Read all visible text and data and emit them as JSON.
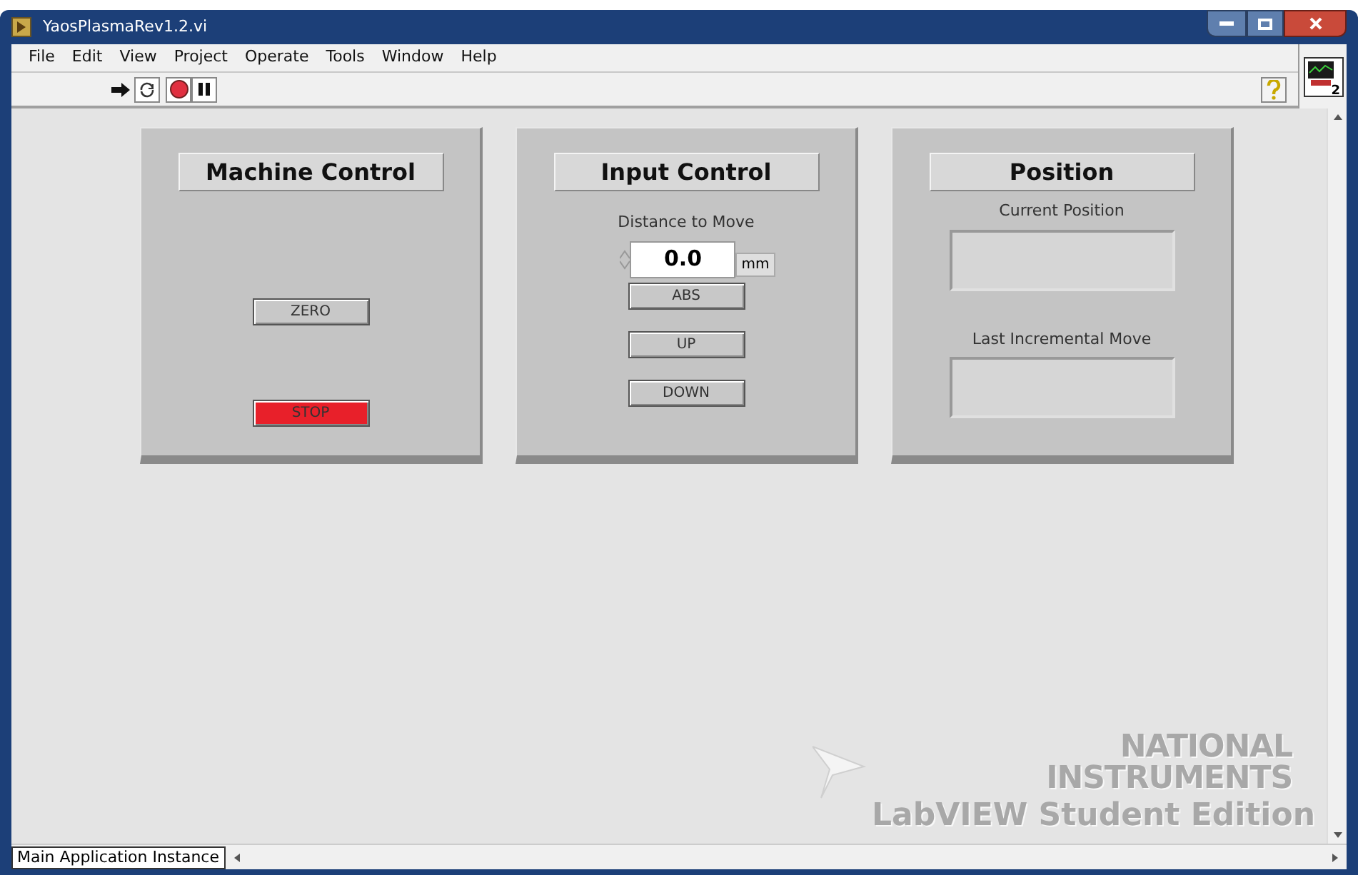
{
  "window": {
    "title": "YaosPlasmaRev1.2.vi"
  },
  "menu": [
    "File",
    "Edit",
    "View",
    "Project",
    "Operate",
    "Tools",
    "Window",
    "Help"
  ],
  "connector_badge": "2",
  "panels": [
    {
      "kind": "machine",
      "title": "Machine Control",
      "buttons": [
        {
          "label": "ZERO",
          "color": "#c8c8c8"
        },
        {
          "label": "STOP",
          "color": "#e8202a"
        }
      ]
    },
    {
      "kind": "input",
      "title": "Input Control",
      "field": {
        "label": "Distance to Move",
        "value": "0.0",
        "unit": "mm"
      },
      "buttons": [
        {
          "label": "ABS",
          "color": "#c8c8c8"
        },
        {
          "label": "UP",
          "color": "#c8c8c8"
        },
        {
          "label": "DOWN",
          "color": "#c8c8c8"
        }
      ]
    },
    {
      "kind": "position",
      "title": "Position",
      "indicators": [
        {
          "label": "Current Position"
        },
        {
          "label": "Last Incremental Move"
        }
      ]
    }
  ],
  "watermark": [
    "NATIONAL",
    "INSTRUMENTS",
    "LabVIEW Student Edition"
  ],
  "status_bar": {
    "instance": "Main Application Instance"
  }
}
